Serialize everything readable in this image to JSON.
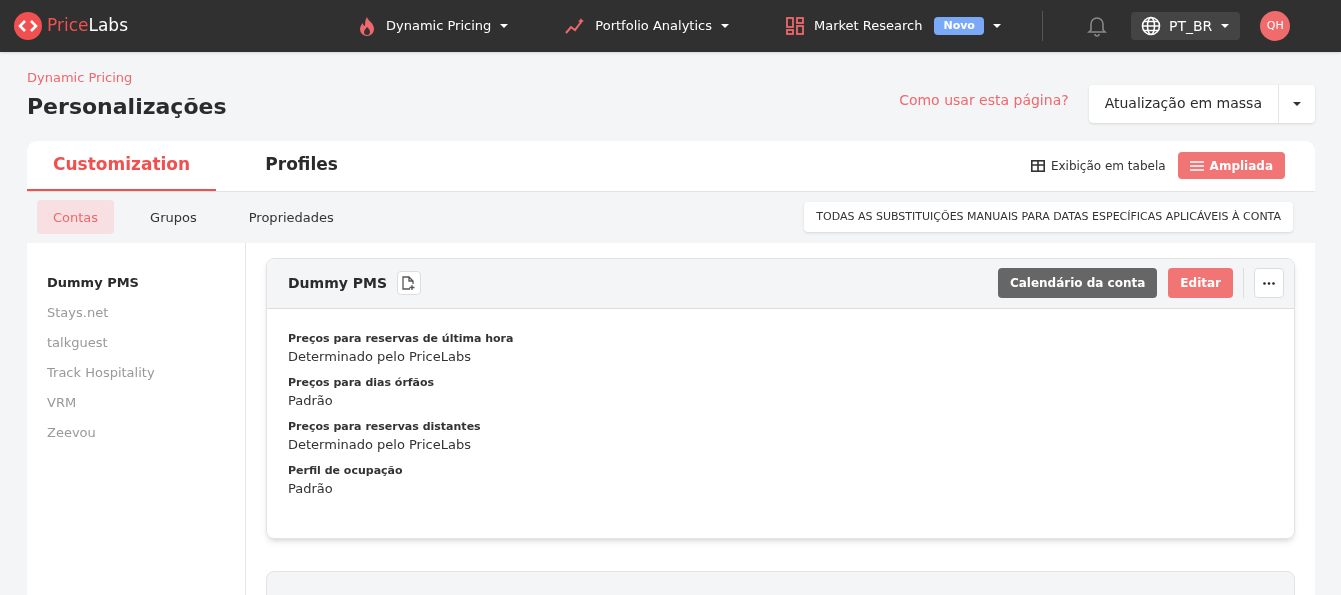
{
  "logo": {
    "first": "Price",
    "second": "Labs"
  },
  "nav": [
    {
      "label": "Dynamic Pricing"
    },
    {
      "label": "Portfolio Analytics"
    },
    {
      "label": "Market Research",
      "badge": "Novo"
    }
  ],
  "language": "PT_BR",
  "avatar": "QH",
  "breadcrumb": "Dynamic Pricing",
  "title": "Personalizações",
  "help_link": "Como usar esta página?",
  "bulk_button": "Atualização em massa",
  "tabs": [
    {
      "label": "Customization",
      "selected": true
    },
    {
      "label": "Profiles",
      "selected": false
    }
  ],
  "views": [
    {
      "label": "Exibição em tabela",
      "selected": false
    },
    {
      "label": "Ampliada",
      "selected": true
    }
  ],
  "subtabs": [
    {
      "label": "Contas",
      "selected": true
    },
    {
      "label": "Grupos",
      "selected": false
    },
    {
      "label": "Propriedades",
      "selected": false
    }
  ],
  "overrides_button": "TODAS AS SUBSTITUIÇÕES MANUAIS PARA DATAS ESPECÍFICAS APLICÁVEIS À CONTA",
  "accounts": [
    {
      "label": "Dummy PMS",
      "selected": true
    },
    {
      "label": "Stays.net",
      "selected": false
    },
    {
      "label": "talkguest",
      "selected": false
    },
    {
      "label": "Track Hospitality",
      "selected": false
    },
    {
      "label": "VRM",
      "selected": false
    },
    {
      "label": "Zeevou",
      "selected": false
    }
  ],
  "card": {
    "title": "Dummy PMS",
    "calendar_button": "Calendário da conta",
    "edit_button": "Editar",
    "settings": [
      {
        "label": "Preços para reservas de última hora",
        "value": "Determinado pelo PriceLabs"
      },
      {
        "label": "Preços para dias órfãos",
        "value": "Padrão"
      },
      {
        "label": "Preços para reservas distantes",
        "value": "Determinado pelo PriceLabs"
      },
      {
        "label": "Perfil de ocupação",
        "value": "Padrão"
      }
    ]
  }
}
